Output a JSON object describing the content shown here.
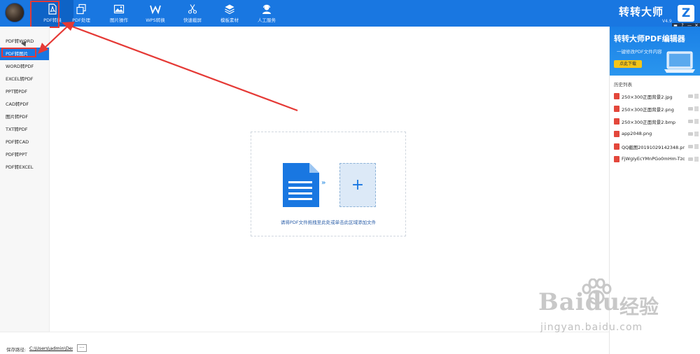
{
  "topbar": {
    "nav": [
      {
        "label": "PDF转换",
        "icon": "pdf-icon"
      },
      {
        "label": "PDF处理",
        "icon": "layers-icon"
      },
      {
        "label": "图片操作",
        "icon": "image-icon"
      },
      {
        "label": "WPS转换",
        "icon": "wps-icon"
      },
      {
        "label": "快速截屏",
        "icon": "scissors-icon"
      },
      {
        "label": "模板素材",
        "icon": "stack-icon"
      },
      {
        "label": "人工服务",
        "icon": "headset-icon"
      }
    ],
    "brand": "转转大师",
    "version": "V4.9",
    "brand_logo": "Z",
    "window_controls": [
      "▬",
      "?",
      "—",
      "✕"
    ]
  },
  "sidebar": {
    "items": [
      {
        "label": "PDF转WORD"
      },
      {
        "label": "PDF转图片"
      },
      {
        "label": "WORD转PDF"
      },
      {
        "label": "EXCEL转PDF"
      },
      {
        "label": "PPT转PDF"
      },
      {
        "label": "CAD转PDF"
      },
      {
        "label": "图片转PDF"
      },
      {
        "label": "TXT转PDF"
      },
      {
        "label": "PDF转CAD"
      },
      {
        "label": "PDF转PPT"
      },
      {
        "label": "PDF转EXCEL"
      }
    ],
    "selected_index": 1
  },
  "dropzone": {
    "arrows": "»",
    "plus": "+",
    "hint": "请将PDF文件拖拽至此处或单击此区域添加文件"
  },
  "status": {
    "path_label": "保存路径:",
    "path_value": "C:\\Users\\admin\\Desl",
    "more": "···"
  },
  "right_panel": {
    "ad_title": "转转大师PDF编辑器",
    "ad_subtitle": "一键修改PDF文件内容",
    "ad_button": "点此下载",
    "history_title": "历史列表",
    "history": [
      {
        "name": "250×300正面背景2.jpg"
      },
      {
        "name": "250×300正面背景2.png"
      },
      {
        "name": "250×300正面背景2.bmp"
      },
      {
        "name": "app2048.png"
      },
      {
        "name": "QQ截图20191029142348.png"
      },
      {
        "name": "FjWgIyEcYMnPGo0mHm-Tzq..."
      }
    ]
  },
  "watermark": {
    "brand": "Bai",
    "brand2": "du",
    "cn": "经验",
    "url": "jingyan.baidu.com"
  },
  "colors": {
    "primary": "#1977e1",
    "annotation": "#e53935",
    "file_icon": "#e3473b"
  }
}
